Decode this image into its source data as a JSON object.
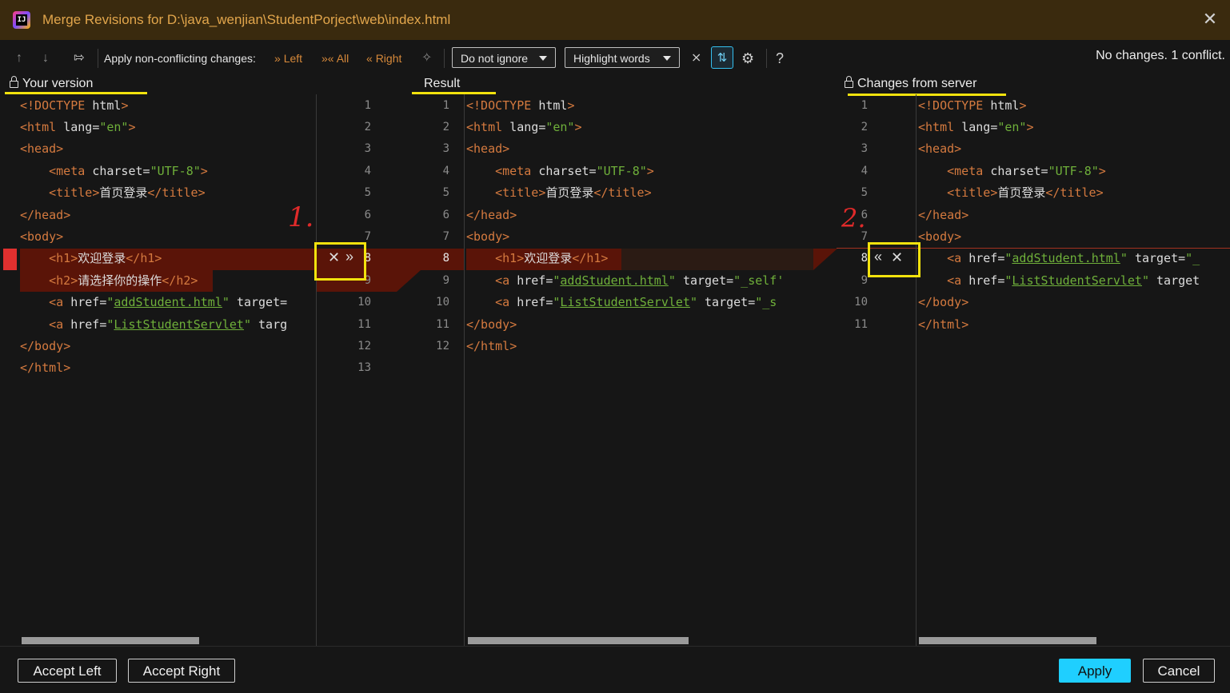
{
  "window": {
    "title": "Merge Revisions for D:\\java_wenjian\\StudentPorject\\web\\index.html",
    "logo_text": "IJ"
  },
  "toolbar": {
    "apply_label": "Apply non-conflicting changes:",
    "left": "Left",
    "all": "All",
    "right": "Right",
    "ignore_select": "Do not ignore",
    "highlight_select": "Highlight words",
    "help": "?",
    "status": "No changes. 1 conflict."
  },
  "panels": {
    "left_title": "Your version",
    "middle_title": "Result",
    "right_title": "Changes from server"
  },
  "code": {
    "left": [
      "<!DOCTYPE html>",
      "<html lang=\"en\">",
      "<head>",
      "    <meta charset=\"UTF-8\">",
      "    <title>首页登录</title>",
      "</head>",
      "<body>",
      "    <h1>欢迎登录</h1>",
      "    <h2>请选择你的操作</h2>",
      "    <a href=\"addStudent.html\" target=",
      "    <a href=\"ListStudentServlet\" targ",
      "</body>",
      "</html>"
    ],
    "middle": [
      "<!DOCTYPE html>",
      "<html lang=\"en\">",
      "<head>",
      "    <meta charset=\"UTF-8\">",
      "    <title>首页登录</title>",
      "</head>",
      "<body>",
      "    <h1>欢迎登录</h1>",
      "    <a href=\"addStudent.html\" target=\"_self'",
      "    <a href=\"ListStudentServlet\" target=\"_s",
      "</body>",
      "</html>"
    ],
    "right": [
      "<!DOCTYPE html>",
      "<html lang=\"en\">",
      "<head>",
      "    <meta charset=\"UTF-8\">",
      "    <title>首页登录</title>",
      "</head>",
      "<body>",
      "    <a href=\"addStudent.html\" target=\"_",
      "    <a href=\"ListStudentServlet\" target",
      "</body>",
      "</html>"
    ],
    "left_line_numbers": [
      "1",
      "2",
      "3",
      "4",
      "5",
      "6",
      "7",
      "8",
      "9",
      "10",
      "11",
      "12",
      "13"
    ],
    "middle_line_numbers": [
      "1",
      "2",
      "3",
      "4",
      "5",
      "6",
      "7",
      "8",
      "9",
      "10",
      "11",
      "12"
    ],
    "right_line_numbers": [
      "1",
      "2",
      "3",
      "4",
      "5",
      "6",
      "7",
      "8",
      "9",
      "10",
      "11"
    ]
  },
  "annotations": {
    "mark1": "1.",
    "mark2": "2."
  },
  "footer": {
    "accept_left": "Accept Left",
    "accept_right": "Accept Right",
    "apply": "Apply",
    "cancel": "Cancel"
  },
  "colors": {
    "tag": "#d57a3f",
    "string": "#6fb03a",
    "conflict": "#5a1408",
    "highlight": "#f2e20d",
    "apply_button": "#1fcfff"
  }
}
